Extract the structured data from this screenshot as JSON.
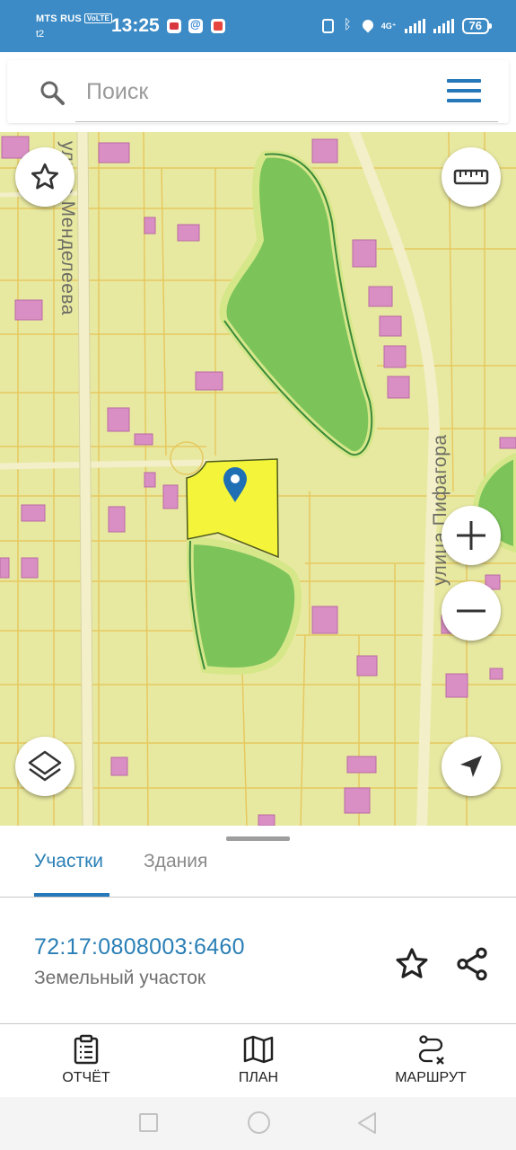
{
  "status_bar": {
    "carrier": "MTS RUS",
    "volte": "VoLTE",
    "carrier2": "t2",
    "time": "13:25",
    "network": "4G⁺",
    "battery": "76"
  },
  "search": {
    "placeholder": "Поиск"
  },
  "map": {
    "street_1": "улица Менделеева",
    "street_2": "улица Пифагора",
    "colors": {
      "background": "#e8e9a1",
      "plot_border": "#e6c85f",
      "building": "#d98fc4",
      "forest": "#7cc45a",
      "selected_parcel": "#f4f53a",
      "marker": "#1f6fb5"
    }
  },
  "sheet": {
    "tabs": [
      {
        "label": "Участки",
        "active": true
      },
      {
        "label": "Здания",
        "active": false
      }
    ],
    "parcel": {
      "cadastral_number": "72:17:0808003:6460",
      "type": "Земельный участок"
    },
    "actions": [
      {
        "label": "ОТЧЁТ",
        "icon": "clipboard-icon"
      },
      {
        "label": "ПЛАН",
        "icon": "map-icon"
      },
      {
        "label": "МАРШРУТ",
        "icon": "route-icon"
      }
    ]
  },
  "accent_color": "#2678b8"
}
